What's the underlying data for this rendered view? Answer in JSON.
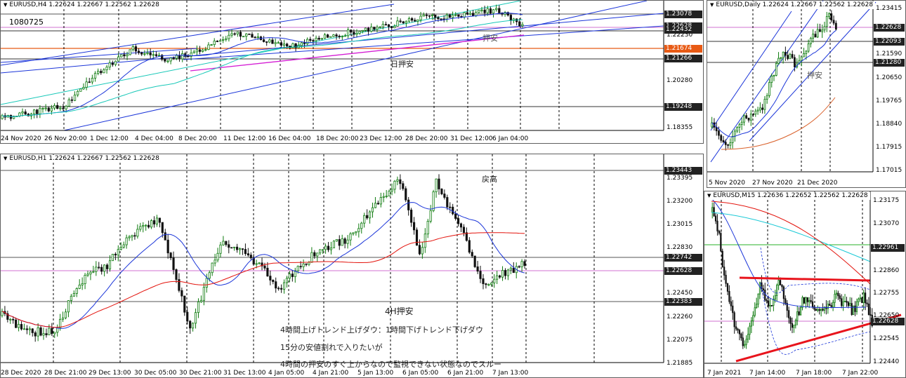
{
  "colors": {
    "up": "#0e7b0e",
    "down": "#111111",
    "ma_blue": "#1b35d9",
    "ma_red": "#e3120b",
    "ma_magenta": "#d41ed4",
    "ma_cyan": "#18c8b8",
    "ma_orange": "#d9602a",
    "trend_red": "#e8141c",
    "box_dark": "#222222",
    "box_orange": "#e85a14"
  },
  "panels": {
    "h4": {
      "title": "EURUSD,H4  1.22624 1.22667 1.22562 1.22628",
      "counter": "1080725",
      "scale": [
        "1.23078",
        "1.22230",
        "1.21674",
        "1.21266",
        "1.20280",
        "1.19248",
        "1.18355"
      ],
      "price_boxes": [
        {
          "label": "1.23078",
          "color": "#222222"
        },
        {
          "label": "1.22628",
          "color": "#222222"
        },
        {
          "label": "1.22432",
          "color": "#222222"
        },
        {
          "label": "1.21674",
          "color": "#e85a14"
        },
        {
          "label": "1.21266",
          "color": "#222222"
        },
        {
          "label": "1.19248",
          "color": "#222222"
        }
      ],
      "times": [
        "24 Nov 2020",
        "26 Nov 20:00",
        "1 Dec 12:00",
        "4 Dec 04:00",
        "8 Dec 20:00",
        "11 Dec 12:00",
        "16 Dec 04:00",
        "18 Dec 20:00",
        "23 Dec 12:00",
        "28 Dec 20:00",
        "31 Dec 12:00",
        "6 Jan 04:00"
      ],
      "notes": [
        "日押安",
        "押安"
      ]
    },
    "daily": {
      "title": "EURUSD,Daily  1.22624 1.22667 1.22562 1.22628",
      "scale": [
        "1.23415",
        "1.22628",
        "1.22093",
        "1.21590",
        "1.21280",
        "1.20650",
        "1.19765",
        "1.18840",
        "1.17915",
        "1.17015"
      ],
      "price_boxes": [
        {
          "label": "1.22628",
          "color": "#222222"
        },
        {
          "label": "1.22093",
          "color": "#222222"
        },
        {
          "label": "1.21280",
          "color": "#222222"
        }
      ],
      "times": [
        "5 Nov 2020",
        "27 Nov 2020",
        "21 Dec 2020"
      ],
      "notes": [
        "押安"
      ]
    },
    "h1": {
      "title": "EURUSD,H1  1.22624 1.22667 1.22562 1.22628",
      "scale": [
        "1.23443",
        "1.23395",
        "1.23200",
        "1.23015",
        "1.22830",
        "1.22742",
        "1.22628",
        "1.22450",
        "1.22383",
        "1.22260",
        "1.22075",
        "1.21885"
      ],
      "price_boxes": [
        {
          "label": "1.23443",
          "color": "#222222"
        },
        {
          "label": "1.22742",
          "color": "#222222"
        },
        {
          "label": "1.22628",
          "color": "#222222"
        },
        {
          "label": "1.22383",
          "color": "#222222"
        }
      ],
      "times": [
        "28 Dec 2020",
        "28 Dec 21:00",
        "29 Dec 13:00",
        "30 Dec 05:00",
        "30 Dec 21:00",
        "31 Dec 13:00",
        "4 Jan 05:00",
        "4 Jan 21:00",
        "5 Jan 13:00",
        "6 Jan 05:00",
        "6 Jan 21:00",
        "7 Jan 13:00"
      ],
      "notes": [
        "戻高",
        "4H押安",
        "4時間上げトレンド上げダウ：1時間下げトレンド下げダウ",
        "15分の安値割れで入りたいが",
        "4時間の押安のすぐ上からなので監視できない状態なのでスルー"
      ]
    },
    "m15": {
      "title": "EURUSD,M15  1.22636 1.22652 1.22562 1.22628",
      "scale": [
        "1.23175",
        "1.23070",
        "1.22961",
        "1.22860",
        "1.22755",
        "1.22650",
        "1.22628",
        "1.22545",
        "1.22440"
      ],
      "price_boxes": [
        {
          "label": "1.22961",
          "color": "#222222"
        },
        {
          "label": "1.22628",
          "color": "#222222"
        }
      ],
      "times": [
        "7 Jan 2021",
        "7 Jan 14:00",
        "7 Jan 18:00",
        "7 Jan 22:00"
      ]
    }
  }
}
